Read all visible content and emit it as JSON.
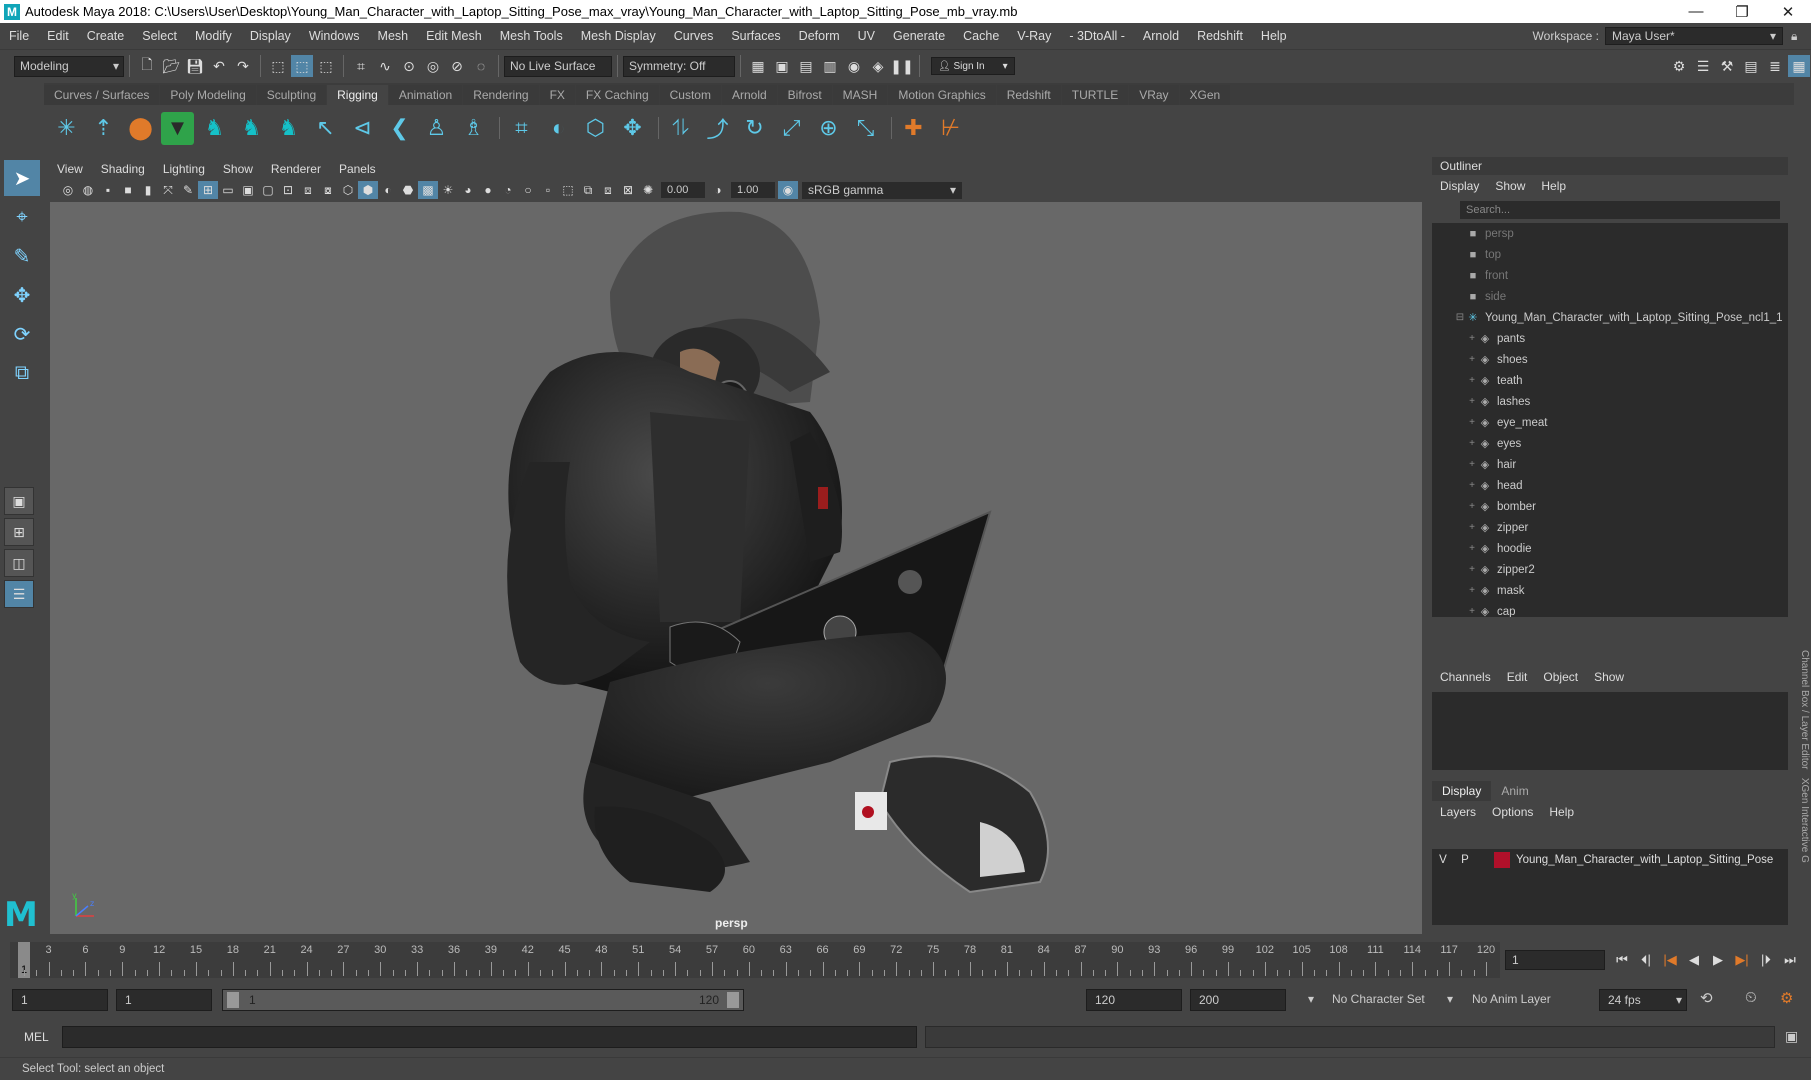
{
  "window": {
    "title": "Autodesk Maya 2018: C:\\Users\\User\\Desktop\\Young_Man_Character_with_Laptop_Sitting_Pose_max_vray\\Young_Man_Character_with_Laptop_Sitting_Pose_mb_vray.mb",
    "app_icon": "M"
  },
  "menubar": {
    "items": [
      "File",
      "Edit",
      "Create",
      "Select",
      "Modify",
      "Display",
      "Windows",
      "Mesh",
      "Edit Mesh",
      "Mesh Tools",
      "Mesh Display",
      "Curves",
      "Surfaces",
      "Deform",
      "UV",
      "Generate",
      "Cache",
      "V-Ray",
      "- 3DtoAll -",
      "Arnold",
      "Redshift",
      "Help"
    ],
    "workspace_label": "Workspace :",
    "workspace_value": "Maya User*"
  },
  "statusline": {
    "mode": "Modeling",
    "live_surface": "No Live Surface",
    "symmetry": "Symmetry: Off",
    "sign_in": "Sign In"
  },
  "shelf": {
    "tabs": [
      "Curves / Surfaces",
      "Poly Modeling",
      "Sculpting",
      "Rigging",
      "Animation",
      "Rendering",
      "FX",
      "FX Caching",
      "Custom",
      "Arnold",
      "Bifrost",
      "MASH",
      "Motion Graphics",
      "Redshift",
      "TURTLE",
      "VRay",
      "XGen"
    ],
    "selected_tab": "Rigging"
  },
  "viewport": {
    "menu": [
      "View",
      "Shading",
      "Lighting",
      "Show",
      "Renderer",
      "Panels"
    ],
    "exposure": "0.00",
    "gamma": "1.00",
    "color_space": "sRGB gamma",
    "camera_label": "persp",
    "axis_y": "y",
    "axis_z": "z"
  },
  "outliner": {
    "title": "Outliner",
    "menu": [
      "Display",
      "Show",
      "Help"
    ],
    "search_placeholder": "Search...",
    "cameras": [
      "persp",
      "top",
      "front",
      "side"
    ],
    "group": "Young_Man_Character_with_Laptop_Sitting_Pose_ncl1_1",
    "children": [
      "pants",
      "shoes",
      "teath",
      "lashes",
      "eye_meat",
      "eyes",
      "hair",
      "head",
      "bomber",
      "zipper",
      "hoodie",
      "zipper2",
      "mask",
      "cap"
    ]
  },
  "channelbox": {
    "menu": [
      "Channels",
      "Edit",
      "Object",
      "Show"
    ],
    "side_label": "Channel Box / Layer Editor",
    "side_label2": "XGen Interactive G"
  },
  "layers": {
    "tabs": [
      "Display",
      "Anim"
    ],
    "selected_tab": "Display",
    "menu": [
      "Layers",
      "Options",
      "Help"
    ],
    "layer": {
      "v": "V",
      "p": "P",
      "name": "Young_Man_Character_with_Laptop_Sitting_Pose",
      "color": "#b0102a"
    }
  },
  "timeslider": {
    "current_frame": "1",
    "ticks": [
      3,
      6,
      9,
      12,
      15,
      18,
      21,
      24,
      27,
      30,
      33,
      36,
      39,
      42,
      45,
      48,
      51,
      54,
      57,
      60,
      63,
      66,
      69,
      72,
      75,
      78,
      81,
      84,
      87,
      90,
      93,
      96,
      99,
      102,
      105,
      108,
      111,
      114,
      117,
      120
    ],
    "frame_field": "1"
  },
  "range": {
    "start": "1",
    "start2": "1",
    "slider_start": "1",
    "slider_end": "120",
    "end": "120",
    "end2": "200",
    "character_set": "No Character Set",
    "anim_layer": "No Anim Layer",
    "fps": "24 fps"
  },
  "cmdline": {
    "label": "MEL"
  },
  "helpline": {
    "text": "Select Tool: select an object"
  }
}
